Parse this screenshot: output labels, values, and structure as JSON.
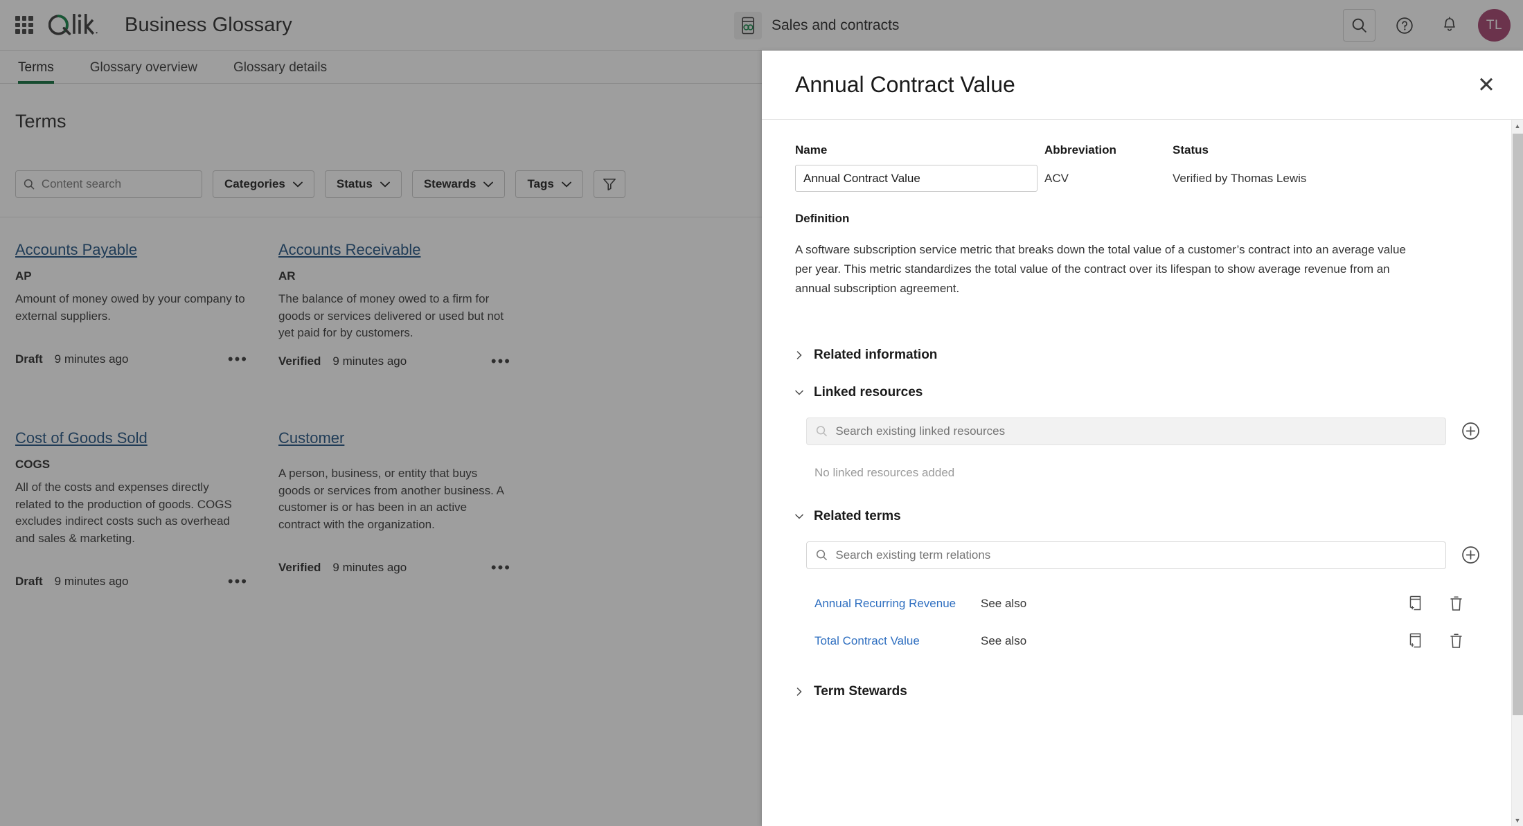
{
  "topbar": {
    "grid_icon": "app-grid-icon",
    "brand": "Qlik",
    "app_title": "Business Glossary",
    "glossary_icon": "glossary-book-icon",
    "glossary_name": "Sales and contracts",
    "search_icon": "search-icon",
    "help_icon": "help-circle-icon",
    "notifications_icon": "bell-icon",
    "avatar_initials": "TL",
    "avatar_color": "#a23d6b"
  },
  "tabs": [
    {
      "label": "Terms",
      "active": true
    },
    {
      "label": "Glossary overview",
      "active": false
    },
    {
      "label": "Glossary details",
      "active": false
    }
  ],
  "accent_color": "#0a6b38",
  "page": {
    "title": "Terms"
  },
  "filters": {
    "search_placeholder": "Content search",
    "search_value": "",
    "search_icon": "search-icon",
    "buttons": [
      {
        "label": "Categories",
        "icon": "chevron-down-icon"
      },
      {
        "label": "Status",
        "icon": "chevron-down-icon"
      },
      {
        "label": "Stewards",
        "icon": "chevron-down-icon"
      },
      {
        "label": "Tags",
        "icon": "chevron-down-icon"
      }
    ],
    "funnel_icon": "filter-funnel-icon"
  },
  "terms": [
    {
      "name": "Accounts Payable",
      "abbreviation": "AP",
      "description": "Amount of money owed by your company to external suppliers.",
      "status": "Draft",
      "updated": "9 minutes ago",
      "menu_icon": "kebab-menu-icon"
    },
    {
      "name": "Accounts Receivable",
      "abbreviation": "AR",
      "description": "The balance of money owed to a firm for goods or services delivered or used but not yet paid for by customers.",
      "status": "Verified",
      "updated": "9 minutes ago",
      "menu_icon": "kebab-menu-icon"
    },
    {
      "name": "Cost of Goods Sold",
      "abbreviation": "COGS",
      "description": "All of the costs and expenses directly related to the production of goods. COGS excludes indirect costs such as overhead and sales & marketing.",
      "status": "Draft",
      "updated": "9 minutes ago",
      "menu_icon": "kebab-menu-icon"
    },
    {
      "name": "Customer",
      "abbreviation": "",
      "description": "A person, business, or entity that buys goods or services from another business. A customer is or has been in an active contract with the organization.",
      "status": "Verified",
      "updated": "9 minutes ago",
      "menu_icon": "kebab-menu-icon"
    }
  ],
  "panel": {
    "title": "Annual Contract Value",
    "close_icon": "close-icon",
    "name_label": "Name",
    "name_value": "Annual Contract Value",
    "abbreviation_label": "Abbreviation",
    "abbreviation_value": "ACV",
    "status_label": "Status",
    "status_value": "Verified by Thomas Lewis",
    "definition_label": "Definition",
    "definition_value": "A software subscription service metric that breaks down the total value of a customer’s contract into an average value per year. This metric standardizes  the total value of the contract over its lifespan to show average revenue from an annual subscription agreement.",
    "sections": {
      "related_information": {
        "label": "Related information",
        "expanded": false,
        "icon": "chevron-right-icon"
      },
      "linked_resources": {
        "label": "Linked resources",
        "expanded": true,
        "icon": "chevron-down-icon",
        "search_placeholder": "Search existing linked resources",
        "search_value": "",
        "search_disabled": true,
        "add_icon": "plus-circle-icon",
        "empty_text": "No linked resources added"
      },
      "related_terms": {
        "label": "Related terms",
        "expanded": true,
        "icon": "chevron-down-icon",
        "search_placeholder": "Search existing term relations",
        "search_value": "",
        "add_icon": "plus-circle-icon",
        "rows": [
          {
            "name": "Annual Recurring Revenue",
            "relation": "See also",
            "add_icon": "add-to-card-icon",
            "delete_icon": "trash-icon"
          },
          {
            "name": "Total Contract Value",
            "relation": "See also",
            "add_icon": "add-to-card-icon",
            "delete_icon": "trash-icon"
          }
        ]
      },
      "term_stewards": {
        "label": "Term Stewards",
        "expanded": false,
        "icon": "chevron-right-icon"
      }
    },
    "scrollbar": {
      "up_icon": "scroll-up-arrow",
      "down_icon": "scroll-down-arrow"
    }
  }
}
